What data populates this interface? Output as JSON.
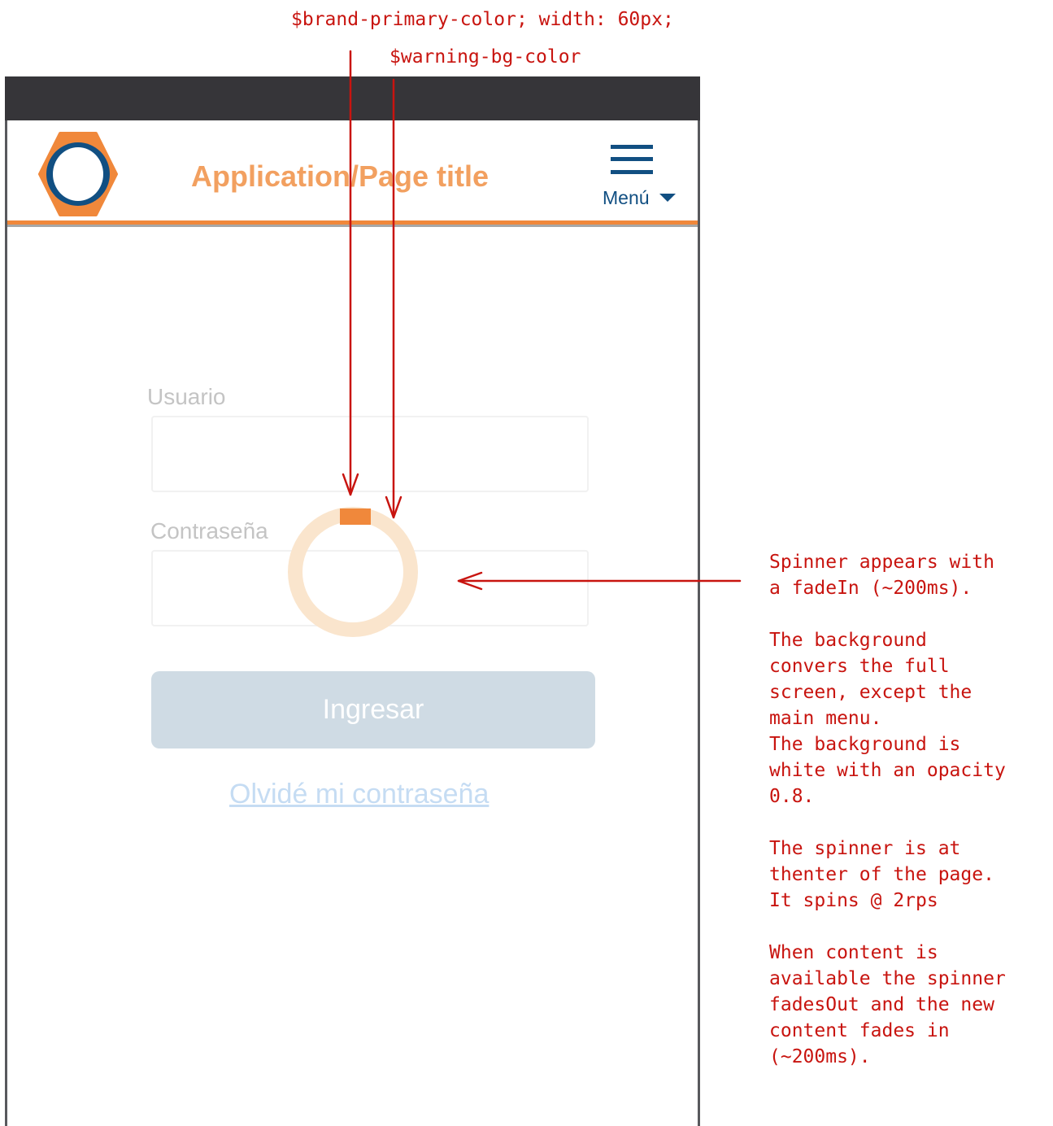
{
  "annotations": {
    "brand_color_note": "$brand-primary-color; width: 60px;",
    "warning_color_note": "$warning-bg-color",
    "spinner_notes": [
      [
        "Spinner appears with",
        "a fadeIn (~200ms)."
      ],
      [
        "The background",
        "convers the full",
        "screen, except the",
        "main menu.",
        "The background is",
        "white with an opacity",
        "0.8."
      ],
      [
        "The spinner is at",
        "thenter of the page.",
        "It spins @ 2rps"
      ],
      [
        "When content is",
        "available the spinner",
        "fadesOut and the new",
        "content fades in",
        "(~200ms)."
      ]
    ]
  },
  "header": {
    "title": "Application/Page title",
    "menu_label": "Menú",
    "logo_icon": "hexagon-ring-logo"
  },
  "login": {
    "username_label": "Usuario",
    "password_label": "Contraseña",
    "submit_label": "Ingresar",
    "forgot_password": "Olvidé mi contraseña"
  },
  "colors": {
    "brand_primary": "#f0883b",
    "warning_bg": "#fae5cd",
    "navy": "#114f82",
    "annotation": "#c8140f",
    "status_bar": "#363539"
  }
}
